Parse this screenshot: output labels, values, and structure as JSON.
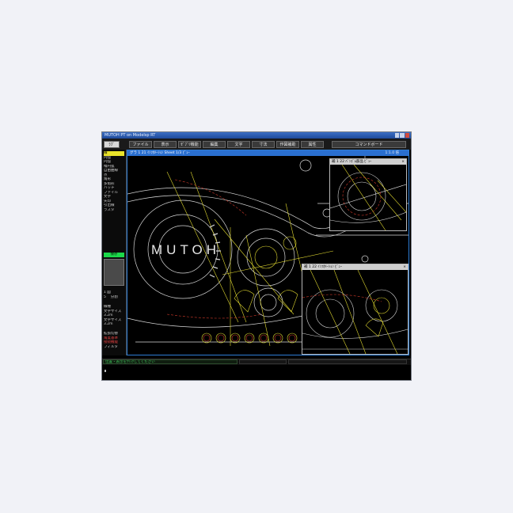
{
  "window": {
    "title": "MUTOH PT on Modelsp RT"
  },
  "menu": [
    {
      "label": "ﾗﾌﾞ"
    },
    {
      "label": "ファイル"
    },
    {
      "label": "表示"
    },
    {
      "label": "ｾﾞﾌﾞﾘ機能"
    },
    {
      "label": "編集"
    },
    {
      "label": "文字"
    },
    {
      "label": "寸法"
    },
    {
      "label": "作図補助"
    },
    {
      "label": "属性"
    },
    {
      "label": "コマンドボード"
    }
  ],
  "tools": [
    "線",
    "円弧",
    "円弧",
    "楕円弧",
    "自由曲線",
    "点",
    "角形",
    "多角形",
    "ハッチ",
    "ファイル",
    "文字",
    "矢印",
    "引出線",
    "ラスタ"
  ],
  "green_label": "保存",
  "side_a": [
    "1 図",
    "5 　分割"
  ],
  "side_b": [
    "線種",
    "文字サイズ",
    "3.2m",
    "文字サイズ",
    "3.2m"
  ],
  "side_c": [
    "拡張切替",
    "角度基準",
    "接続機能",
    "フィルタ"
  ],
  "canvas": {
    "title": "グラ 1 21 ｲﾝﾌｵﾒｰｼｮﾝ Sheet 1/3 ﾋﾞｭｰ",
    "zoom": "1:1.0 倍",
    "logo_text": "MUTOH"
  },
  "sub_views": [
    {
      "title": "補 1 22 ﾊﾞﾝｺﾞﾑ部品 ﾋﾞｭｰ"
    },
    {
      "title": "補 1 22 ｲﾝﾌｵﾒｰｼｮﾝ ﾋﾞｭｰ"
    }
  ],
  "status": {
    "text": "位置・表示をｸﾘｯｸしてください"
  },
  "colors": {
    "accent": "#2e7dd6",
    "drawing_white": "#d8d8d8",
    "drawing_yellow": "#e0d830",
    "drawing_red": "#d03a2a",
    "status_green": "#1bd94a"
  }
}
